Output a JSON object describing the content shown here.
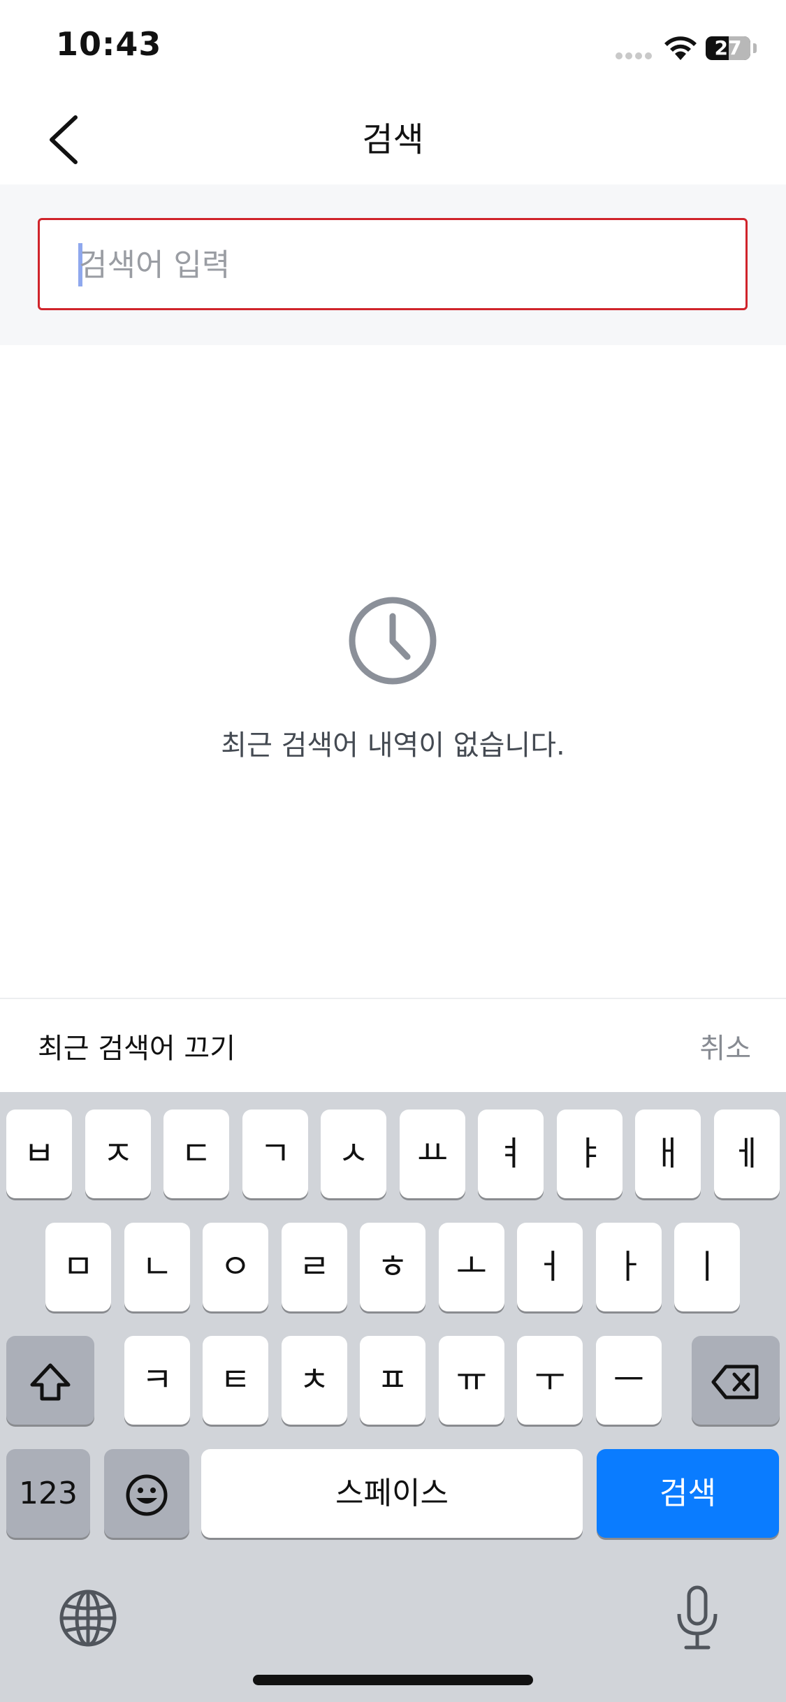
{
  "status_bar": {
    "time": "10:43",
    "battery_percent": "27"
  },
  "nav": {
    "title": "검색"
  },
  "search": {
    "placeholder": "검색어 입력",
    "value": ""
  },
  "empty_state": {
    "message": "최근 검색어 내역이 없습니다."
  },
  "bottom_bar": {
    "disable_recent_label": "최근 검색어 끄기",
    "cancel_label": "취소"
  },
  "keyboard": {
    "row1": [
      "ㅂ",
      "ㅈ",
      "ㄷ",
      "ㄱ",
      "ㅅ",
      "ㅛ",
      "ㅕ",
      "ㅑ",
      "ㅐ",
      "ㅔ"
    ],
    "row2": [
      "ㅁ",
      "ㄴ",
      "ㅇ",
      "ㄹ",
      "ㅎ",
      "ㅗ",
      "ㅓ",
      "ㅏ",
      "ㅣ"
    ],
    "row3": [
      "ㅋ",
      "ㅌ",
      "ㅊ",
      "ㅍ",
      "ㅠ",
      "ㅜ",
      "ㅡ"
    ],
    "numbers_label": "123",
    "space_label": "스페이스",
    "search_label": "검색",
    "accent_color": "#0a7cff"
  },
  "icons": {
    "back": "chevron-left-icon",
    "clock": "clock-icon",
    "shift": "shift-icon",
    "delete": "backspace-icon",
    "emoji": "emoji-icon",
    "globe": "globe-icon",
    "mic": "microphone-icon"
  },
  "colors": {
    "search_border": "#d0242b",
    "caret": "#8fa8ee",
    "icon_gray": "#8b9099"
  }
}
